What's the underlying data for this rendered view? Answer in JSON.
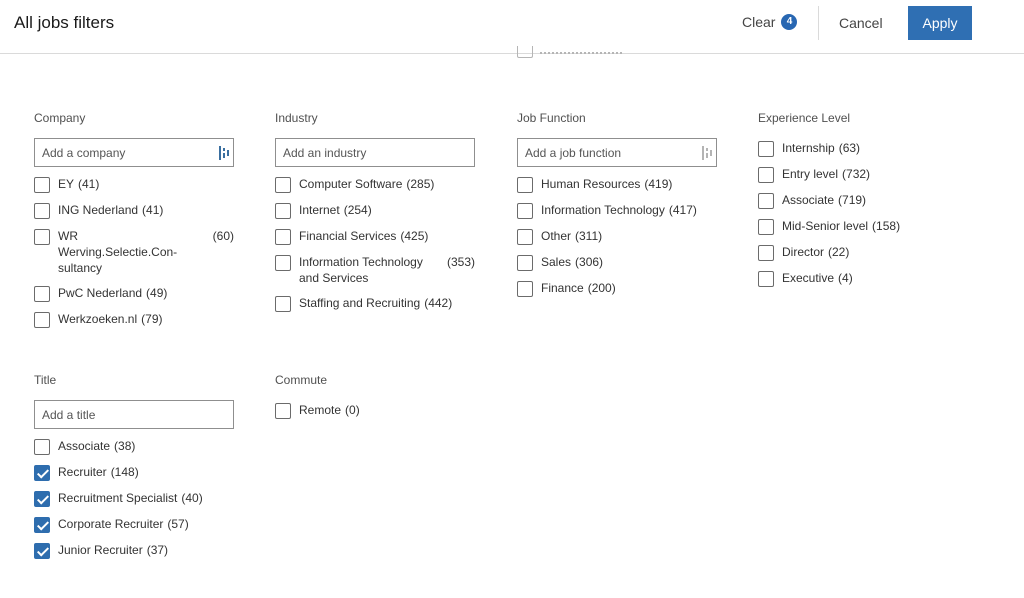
{
  "header": {
    "title": "All jobs filters",
    "clear_label": "Clear",
    "clear_count": "4",
    "cancel_label": "Cancel",
    "apply_label": "Apply"
  },
  "sections": {
    "company": {
      "label": "Company",
      "placeholder": "Add a company",
      "options": [
        {
          "name": "EY",
          "count": "(41)",
          "checked": false
        },
        {
          "name": "ING Nederland",
          "count": "(41)",
          "checked": false
        },
        {
          "name": "WR Werving.Selectie.Con-sultancy",
          "count": "(60)",
          "checked": false
        },
        {
          "name": "PwC Nederland",
          "count": "(49)",
          "checked": false
        },
        {
          "name": "Werkzoeken.nl",
          "count": "(79)",
          "checked": false
        }
      ]
    },
    "industry": {
      "label": "Industry",
      "placeholder": "Add an industry",
      "options": [
        {
          "name": "Computer Software",
          "count": "(285)",
          "checked": false
        },
        {
          "name": "Internet",
          "count": "(254)",
          "checked": false
        },
        {
          "name": "Financial Services",
          "count": "(425)",
          "checked": false
        },
        {
          "name": "Information Technology and Services",
          "count": "(353)",
          "checked": false
        },
        {
          "name": "Staffing and Recruiting",
          "count": "(442)",
          "checked": false
        }
      ]
    },
    "job_function": {
      "label": "Job Function",
      "placeholder": "Add a job function",
      "options": [
        {
          "name": "Human Resources",
          "count": "(419)",
          "checked": false
        },
        {
          "name": "Information Technology",
          "count": "(417)",
          "checked": false
        },
        {
          "name": "Other",
          "count": "(311)",
          "checked": false
        },
        {
          "name": "Sales",
          "count": "(306)",
          "checked": false
        },
        {
          "name": "Finance",
          "count": "(200)",
          "checked": false
        }
      ]
    },
    "experience": {
      "label": "Experience Level",
      "options": [
        {
          "name": "Internship",
          "count": "(63)",
          "checked": false
        },
        {
          "name": "Entry level",
          "count": "(732)",
          "checked": false
        },
        {
          "name": "Associate",
          "count": "(719)",
          "checked": false
        },
        {
          "name": "Mid-Senior level",
          "count": "(158)",
          "checked": false
        },
        {
          "name": "Director",
          "count": "(22)",
          "checked": false
        },
        {
          "name": "Executive",
          "count": "(4)",
          "checked": false
        }
      ]
    },
    "title": {
      "label": "Title",
      "placeholder": "Add a title",
      "options": [
        {
          "name": "Associate",
          "count": "(38)",
          "checked": false
        },
        {
          "name": "Recruiter",
          "count": "(148)",
          "checked": true
        },
        {
          "name": "Recruitment Specialist",
          "count": "(40)",
          "checked": true
        },
        {
          "name": "Corporate Recruiter",
          "count": "(57)",
          "checked": true
        },
        {
          "name": "Junior Recruiter",
          "count": "(37)",
          "checked": true
        }
      ]
    },
    "commute": {
      "label": "Commute",
      "options": [
        {
          "name": "Remote",
          "count": "(0)",
          "checked": false
        }
      ]
    }
  },
  "colors": {
    "accent": "#2f6fb3",
    "checked": "#2e6dae",
    "badge": "#2867b2"
  },
  "icons": {
    "typeahead": "typeahead-icon",
    "check": "check-icon"
  }
}
